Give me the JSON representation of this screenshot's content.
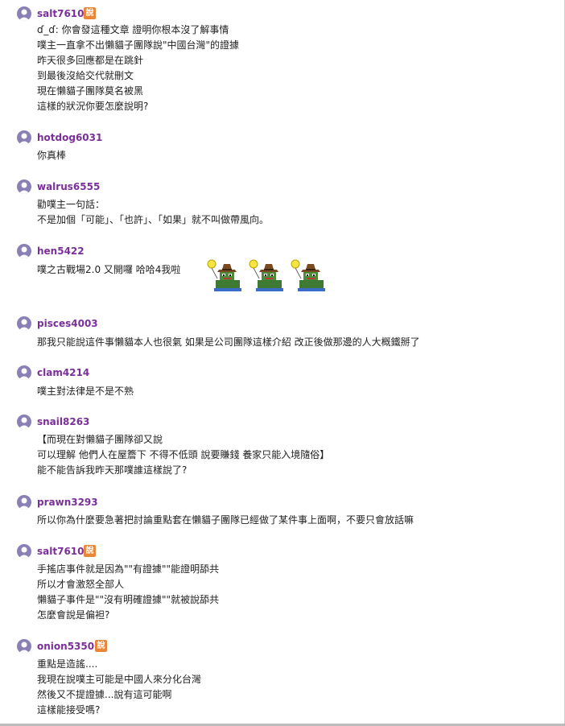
{
  "comments": [
    {
      "user": "salt7610",
      "op": true,
      "op_label": "說",
      "lines": [
        "ɗ_ɗ: 你會發這種文章 證明你根本沒了解事情",
        "噗主一直拿不出懶貓子團隊說\"中國台灣\"的證據",
        "昨天很多回應都是在跳針",
        "到最後沒給交代就刪文",
        "現在懶貓子團隊莫名被黑",
        "這樣的狀況你要怎麼說明?"
      ]
    },
    {
      "user": "hotdog6031",
      "op": false,
      "lines": [
        "你真棒"
      ]
    },
    {
      "user": "walrus6555",
      "op": false,
      "lines": [
        "勸噗主一句話：",
        "不是加個「可能」、「也許」、「如果」就不叫做帶風向。"
      ]
    },
    {
      "user": "hen5422",
      "op": false,
      "lines": [
        "噗之古戰場2.0 又開囉 哈哈4我啦"
      ],
      "sticker": "frog-cowboy-sticker"
    },
    {
      "user": "pisces4003",
      "op": false,
      "lines": [
        "那我只能說這件事懶貓本人也很氣 如果是公司團隊這樣介紹 改正後做那邊的人大概鐵掰了"
      ]
    },
    {
      "user": "clam4214",
      "op": false,
      "lines": [
        "噗主對法律是不是不熟"
      ]
    },
    {
      "user": "snail8263",
      "op": false,
      "lines": [
        "【而現在對懶貓子團隊卻又說",
        "可以理解 他們人在屋簷下 不得不低頭 說要賺錢 養家只能入境隨俗】",
        "能不能告訴我昨天那噗誰這樣說了?"
      ]
    },
    {
      "user": "prawn3293",
      "op": false,
      "lines": [
        "所以你為什麼要急著把討論重點套在懶貓子團隊已經做了某件事上面啊，不要只會放話嘛"
      ]
    },
    {
      "user": "salt7610",
      "op": true,
      "op_label": "說",
      "lines": [
        "手搖店事件就是因為\"\"有證據\"\"能證明舔共",
        "所以才會激怒全部人",
        "懶貓子事件是\"\"沒有明確證據\"\"就被說舔共",
        "怎麼會說是偏袒?"
      ]
    },
    {
      "user": "onion5350",
      "op": true,
      "op_label": "說",
      "lines": [
        "重點是造謠....",
        "我現在說噗主可能是中國人來分化台灣",
        "然後又不提證據...說有這可能啊",
        "這樣能接受嗎?"
      ]
    }
  ],
  "colors": {
    "username": "#7a2f99",
    "op_badge": "#e8863a",
    "avatar": "#8b80b6"
  }
}
